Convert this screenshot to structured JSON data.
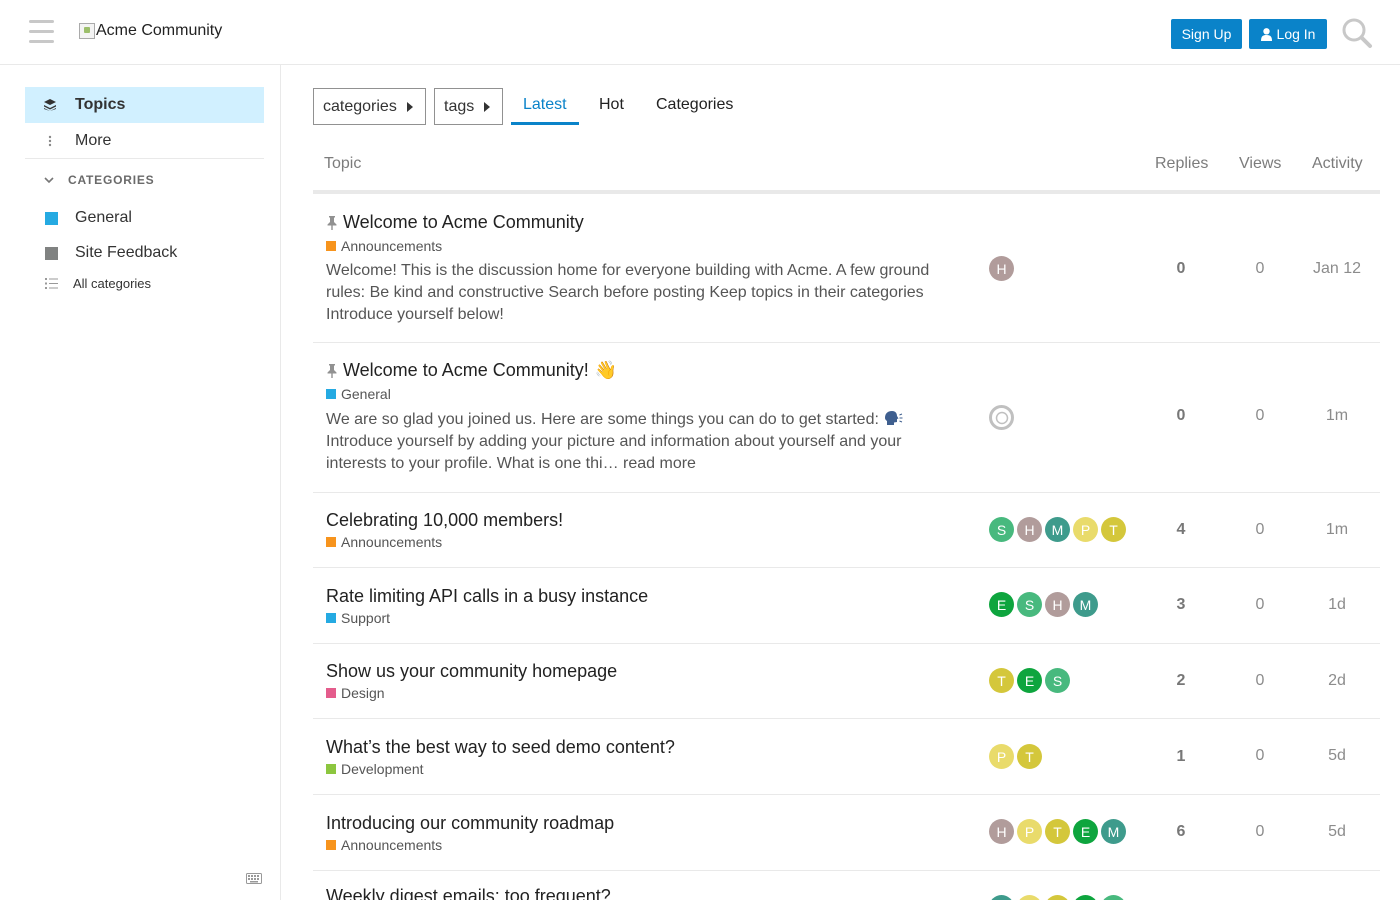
{
  "header": {
    "logo_text": "Acme Community",
    "signup_label": "Sign Up",
    "login_label": "Log In"
  },
  "sidebar": {
    "topics_label": "Topics",
    "more_label": "More",
    "categories_header": "CATEGORIES",
    "categories": [
      {
        "name": "General",
        "color": "#25AAE2"
      },
      {
        "name": "Site Feedback",
        "color": "#808281"
      }
    ],
    "all_categories_label": "All categories"
  },
  "nav": {
    "categories_dropdown": "categories",
    "tags_dropdown": "tags",
    "tabs": [
      "Latest",
      "Hot",
      "Categories"
    ],
    "active_tab": "Latest"
  },
  "table": {
    "columns": {
      "topic": "Topic",
      "replies": "Replies",
      "views": "Views",
      "activity": "Activity"
    },
    "rows": [
      {
        "pinned": true,
        "title": "Welcome to Acme Community",
        "category": "Announcements",
        "category_color": "#F7941D",
        "excerpt": "Welcome! This is the discussion home for everyone building with Acme. A few ground rules: Be kind and constructive Search before posting Keep topics in their categories Introduce yourself below!",
        "posters": [
          {
            "letter": "H",
            "color": "#B19C9B"
          }
        ],
        "replies": "0",
        "views": "0",
        "activity": "Jan 12"
      },
      {
        "pinned": true,
        "title": "Welcome to Acme Community!",
        "emoji": "👋",
        "category": "General",
        "category_color": "#25AAE2",
        "excerpt": "We are so glad you joined us. Here are some things you can do to get started:",
        "excerpt_rest": "Introduce yourself by adding your picture and information about yourself and your interests to your profile. What is one thi…",
        "read_more": "read more",
        "posters": [
          {
            "letter": "",
            "color": "#ffffff"
          }
        ],
        "replies": "0",
        "views": "0",
        "activity": "1m"
      },
      {
        "title": "Celebrating 10,000 members!",
        "category": "Announcements",
        "category_color": "#F7941D",
        "posters": [
          {
            "letter": "S",
            "color": "#48B97E"
          },
          {
            "letter": "H",
            "color": "#B19C9B"
          },
          {
            "letter": "M",
            "color": "#3E9B8C"
          },
          {
            "letter": "P",
            "color": "#E9DB6B"
          },
          {
            "letter": "T",
            "color": "#D4C73B"
          }
        ],
        "replies": "4",
        "views": "0",
        "activity": "1m"
      },
      {
        "title": "Rate limiting API calls in a busy instance",
        "category": "Support",
        "category_color": "#25AAE2",
        "posters": [
          {
            "letter": "E",
            "color": "#0EA53E"
          },
          {
            "letter": "S",
            "color": "#48B97E"
          },
          {
            "letter": "H",
            "color": "#B19C9B"
          },
          {
            "letter": "M",
            "color": "#3E9B8C"
          }
        ],
        "replies": "3",
        "views": "0",
        "activity": "1d"
      },
      {
        "title": "Show us your community homepage",
        "category": "Design",
        "category_color": "#E45C8C",
        "posters": [
          {
            "letter": "T",
            "color": "#D4C73B"
          },
          {
            "letter": "E",
            "color": "#0EA53E"
          },
          {
            "letter": "S",
            "color": "#48B97E"
          }
        ],
        "replies": "2",
        "views": "0",
        "activity": "2d"
      },
      {
        "title": "What’s the best way to seed demo content?",
        "category": "Development",
        "category_color": "#8CC63F",
        "posters": [
          {
            "letter": "P",
            "color": "#E9DB6B"
          },
          {
            "letter": "T",
            "color": "#D4C73B"
          }
        ],
        "replies": "1",
        "views": "0",
        "activity": "5d"
      },
      {
        "title": "Introducing our community roadmap",
        "category": "Announcements",
        "category_color": "#F7941D",
        "posters": [
          {
            "letter": "H",
            "color": "#B19C9B"
          },
          {
            "letter": "P",
            "color": "#E9DB6B"
          },
          {
            "letter": "T",
            "color": "#D4C73B"
          },
          {
            "letter": "E",
            "color": "#0EA53E"
          },
          {
            "letter": "M",
            "color": "#3E9B8C"
          }
        ],
        "replies": "6",
        "views": "0",
        "activity": "5d"
      },
      {
        "title": "Weekly digest emails: too frequent?",
        "posters": [
          {
            "letter": "M",
            "color": "#3E9B8C"
          },
          {
            "letter": "P",
            "color": "#E9DB6B"
          },
          {
            "letter": "T",
            "color": "#D4C73B"
          },
          {
            "letter": "E",
            "color": "#0EA53E"
          },
          {
            "letter": "S",
            "color": "#48B97E"
          }
        ]
      }
    ]
  }
}
